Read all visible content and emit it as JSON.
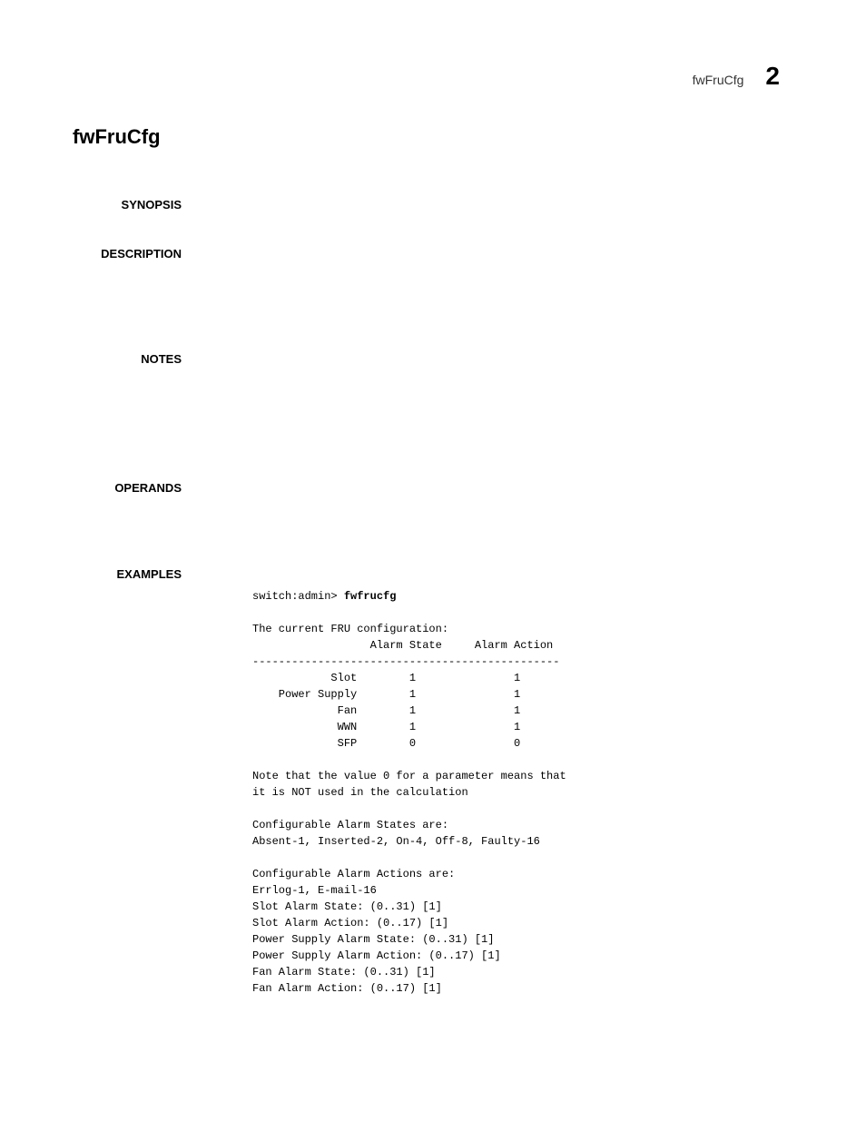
{
  "header": {
    "label": "fwFruCfg",
    "chapter": "2"
  },
  "title": "fwFruCfg",
  "sections": {
    "synopsis": "SYNOPSIS",
    "description": "DESCRIPTION",
    "notes": "NOTES",
    "operands": "OPERANDS",
    "examples": "EXAMPLES"
  },
  "example": {
    "prompt": "switch:admin> ",
    "command": "fwfrucfg",
    "output": "\n\nThe current FRU configuration:\n                  Alarm State     Alarm Action\n-----------------------------------------------\n            Slot        1               1\n    Power Supply        1               1\n             Fan        1               1\n             WWN        1               1\n             SFP        0               0\n\nNote that the value 0 for a parameter means that\nit is NOT used in the calculation\n\nConfigurable Alarm States are:\nAbsent-1, Inserted-2, On-4, Off-8, Faulty-16\n\nConfigurable Alarm Actions are:\nErrlog-1, E-mail-16\nSlot Alarm State: (0..31) [1]\nSlot Alarm Action: (0..17) [1]\nPower Supply Alarm State: (0..31) [1]\nPower Supply Alarm Action: (0..17) [1]\nFan Alarm State: (0..31) [1]\nFan Alarm Action: (0..17) [1]"
  }
}
